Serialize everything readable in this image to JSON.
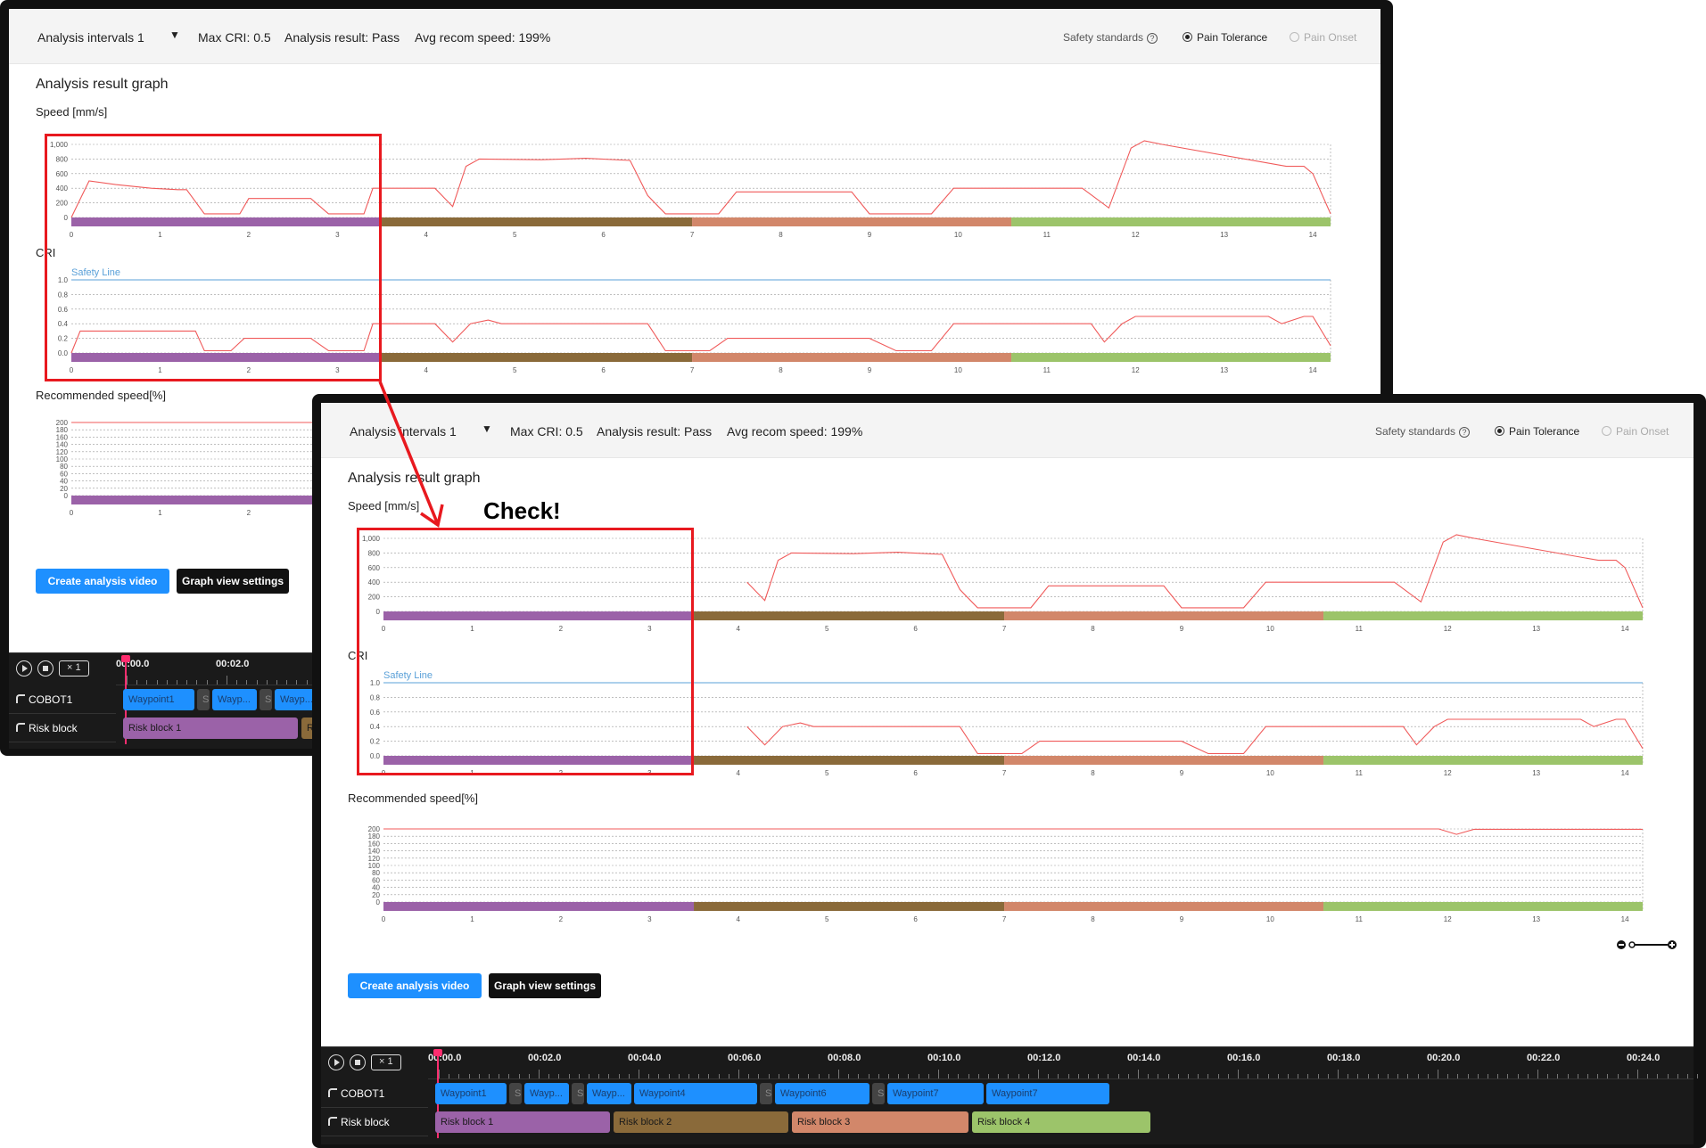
{
  "header": {
    "interval_label": "Analysis intervals 1",
    "max_cri": "Max CRI: 0.5",
    "analysis_result": "Analysis result: Pass",
    "avg_speed": "Avg recom speed: 199%",
    "safety_standards": "Safety standards",
    "opt_pain_tolerance": "Pain Tolerance",
    "opt_pain_onset": "Pain Onset"
  },
  "section": {
    "title": "Analysis result graph",
    "speed_label": "Speed [mm/s]",
    "cri_label": "CRI",
    "safety_line": "Safety Line",
    "recom_label": "Recommended speed[%]"
  },
  "buttons": {
    "create_video": "Create analysis video",
    "graph_settings": "Graph view settings"
  },
  "annotation": {
    "check": "Check!"
  },
  "timeline": {
    "speed": "× 1",
    "ticks": [
      "00:00.0",
      "00:02.0",
      "00:04.0",
      "00:06.0",
      "00:08.0",
      "00:10.0",
      "00:12.0",
      "00:14.0",
      "00:16.0",
      "00:18.0",
      "00:20.0",
      "00:22.0",
      "00:24.0"
    ],
    "tracks": [
      "COBOT1",
      "Risk block"
    ],
    "cobot_clips": [
      "Waypoint1",
      "S",
      "Wayp...",
      "S",
      "Wayp...",
      "Waypoint4",
      "S",
      "Waypoint6",
      "S",
      "Waypoint7",
      "Waypoint7"
    ],
    "risk_clips": [
      "Risk block 1",
      "Risk block 2",
      "Risk block 3",
      "Risk block 4"
    ]
  },
  "colors": {
    "line": "#f05a5a",
    "safety": "#5aa0d8",
    "block1": "#9b62a8",
    "block2": "#8a6a3a",
    "block3": "#d2876a",
    "block4": "#9cc46a",
    "accent": "#1e90ff",
    "annotation": "#e8191f"
  },
  "chart_data": [
    {
      "type": "line",
      "ylabel": "Speed [mm/s]",
      "ylim": [
        0,
        1000
      ],
      "yticks": [
        "0",
        "200",
        "400",
        "600",
        "800",
        "1,000"
      ],
      "xticks": [
        "0",
        "1",
        "2",
        "3",
        "4",
        "5",
        "6",
        "7",
        "8",
        "9",
        "10",
        "11",
        "12",
        "13",
        "14"
      ],
      "xlim": [
        0,
        14.2
      ],
      "series": [
        {
          "points": [
            [
              0,
              0
            ],
            [
              0.1,
              250
            ],
            [
              0.2,
              500
            ],
            [
              0.5,
              450
            ],
            [
              0.9,
              400
            ],
            [
              1.2,
              380
            ],
            [
              1.3,
              380
            ],
            [
              1.5,
              50
            ],
            [
              1.9,
              50
            ],
            [
              2.0,
              260
            ],
            [
              2.7,
              260
            ],
            [
              2.9,
              50
            ],
            [
              3.3,
              50
            ],
            [
              3.4,
              400
            ],
            [
              4.1,
              400
            ],
            [
              4.3,
              150
            ],
            [
              4.45,
              700
            ],
            [
              4.6,
              800
            ],
            [
              5.3,
              790
            ],
            [
              5.8,
              810
            ],
            [
              6.3,
              780
            ],
            [
              6.5,
              300
            ],
            [
              6.7,
              50
            ],
            [
              7.3,
              50
            ],
            [
              7.5,
              350
            ],
            [
              8.8,
              350
            ],
            [
              9.0,
              50
            ],
            [
              9.7,
              50
            ],
            [
              9.95,
              400
            ],
            [
              11.4,
              400
            ],
            [
              11.7,
              130
            ],
            [
              11.95,
              950
            ],
            [
              12.1,
              1050
            ],
            [
              12.3,
              1000
            ],
            [
              13.7,
              700
            ],
            [
              13.9,
              700
            ],
            [
              14.0,
              600
            ],
            [
              14.2,
              50
            ]
          ]
        }
      ],
      "blocks": [
        [
          0,
          3.5
        ],
        [
          3.5,
          7
        ],
        [
          7,
          10.6
        ],
        [
          10.6,
          14.2
        ]
      ]
    },
    {
      "type": "line",
      "ylabel": "CRI",
      "ylim": [
        0,
        1.0
      ],
      "yticks": [
        "0.0",
        "0.2",
        "0.4",
        "0.6",
        "0.8",
        "1.0"
      ],
      "xticks": [
        "0",
        "1",
        "2",
        "3",
        "4",
        "5",
        "6",
        "7",
        "8",
        "9",
        "10",
        "11",
        "12",
        "13",
        "14"
      ],
      "xlim": [
        0,
        14.2
      ],
      "safety_line": 1.0,
      "series": [
        {
          "points": [
            [
              0,
              0
            ],
            [
              0.1,
              0.3
            ],
            [
              0.2,
              0.3
            ],
            [
              1.4,
              0.3
            ],
            [
              1.5,
              0.03
            ],
            [
              1.8,
              0.03
            ],
            [
              1.95,
              0.2
            ],
            [
              2.7,
              0.2
            ],
            [
              2.9,
              0.03
            ],
            [
              3.3,
              0.03
            ],
            [
              3.4,
              0.4
            ],
            [
              4.1,
              0.4
            ],
            [
              4.3,
              0.15
            ],
            [
              4.5,
              0.4
            ],
            [
              4.7,
              0.45
            ],
            [
              4.85,
              0.4
            ],
            [
              6.5,
              0.4
            ],
            [
              6.7,
              0.03
            ],
            [
              7.2,
              0.03
            ],
            [
              7.4,
              0.2
            ],
            [
              9.0,
              0.2
            ],
            [
              9.3,
              0.03
            ],
            [
              9.7,
              0.03
            ],
            [
              9.95,
              0.4
            ],
            [
              11.5,
              0.4
            ],
            [
              11.65,
              0.15
            ],
            [
              11.85,
              0.4
            ],
            [
              12.0,
              0.5
            ],
            [
              13.5,
              0.5
            ],
            [
              13.65,
              0.4
            ],
            [
              13.9,
              0.5
            ],
            [
              14.0,
              0.5
            ],
            [
              14.2,
              0.1
            ]
          ]
        }
      ],
      "blocks": [
        [
          0,
          3.5
        ],
        [
          3.5,
          7
        ],
        [
          7,
          10.6
        ],
        [
          10.6,
          14.2
        ]
      ]
    },
    {
      "type": "line",
      "ylabel": "Recommended speed[%]",
      "ylim": [
        0,
        200
      ],
      "yticks": [
        "0",
        "20",
        "40",
        "60",
        "80",
        "100",
        "120",
        "140",
        "160",
        "180",
        "200"
      ],
      "xticks": [
        "0",
        "1",
        "2",
        "3",
        "4",
        "5",
        "6",
        "7",
        "8",
        "9",
        "10",
        "11",
        "12",
        "13",
        "14"
      ],
      "xlim": [
        0,
        14.2
      ],
      "series": [
        {
          "points": [
            [
              0,
              200
            ],
            [
              11.9,
              200
            ],
            [
              12.1,
              185
            ],
            [
              12.3,
              199
            ],
            [
              14.2,
              199
            ]
          ]
        }
      ],
      "blocks": [
        [
          0,
          3.5
        ],
        [
          3.5,
          7
        ],
        [
          7,
          10.6
        ],
        [
          10.6,
          14.2
        ]
      ]
    }
  ]
}
